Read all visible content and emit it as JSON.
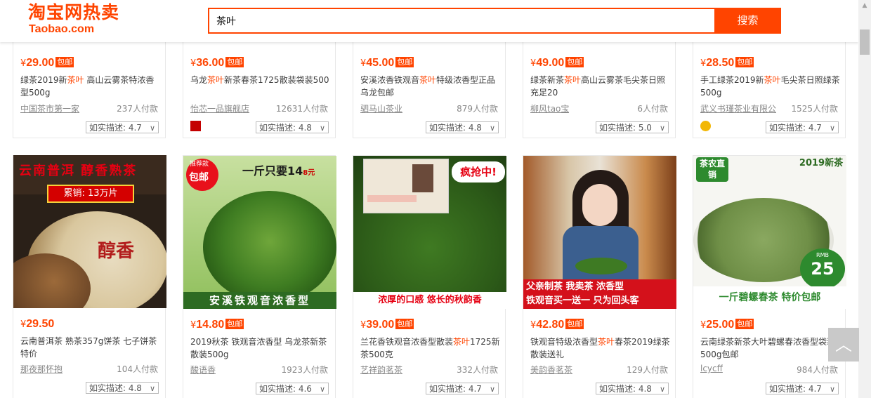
{
  "header": {
    "logo_main": "淘宝网热卖",
    "logo_sub": "Taobao.com",
    "search_value": "茶叶",
    "search_button": "搜索"
  },
  "top_row": [
    {
      "price": "29.00",
      "baoyou": "包邮",
      "title_pre": "绿茶2019新",
      "hl": "茶叶",
      "title_post": " 高山云雾茶特浓香型500g",
      "shop": "中国茶市第一家",
      "sales": "237人付款",
      "rating": "如实描述: 4.7",
      "shop_icon": "none"
    },
    {
      "price": "36.00",
      "baoyou": "包邮",
      "title_pre": "乌龙",
      "hl": "茶叶",
      "title_post": "新茶春茶1725散装袋装500",
      "shop": "怡芯一品旗舰店",
      "sales": "12631人付款",
      "rating": "如实描述: 4.8",
      "shop_icon": "tmall-icon"
    },
    {
      "price": "45.00",
      "baoyou": "包邮",
      "title_pre": "安溪浓香铁观音",
      "hl": "茶叶",
      "title_post": "特级浓香型正品乌龙包邮",
      "shop": "驷马山茶业",
      "sales": "879人付款",
      "rating": "如实描述: 4.8",
      "shop_icon": "none"
    },
    {
      "price": "49.00",
      "baoyou": "包邮",
      "title_pre": "绿茶新茶",
      "hl": "茶叶",
      "title_post": "高山云雾茶毛尖茶日照充足20",
      "shop": "柳风tao宝",
      "sales": "6人付款",
      "rating": "如实描述: 5.0",
      "shop_icon": "none"
    },
    {
      "price": "28.50",
      "baoyou": "包邮",
      "title_pre": "手工绿茶2019新",
      "hl": "茶叶",
      "title_post": "毛尖茶日照绿茶500g",
      "shop": "武义书瑾茶业有限公",
      "sales": "1525人付款",
      "rating": "如实描述: 4.7",
      "shop_icon": "gold-crown-icon"
    }
  ],
  "bottom_row": [
    {
      "price": "29.50",
      "baoyou": "",
      "title_pre": "云南普洱茶 熟茶357g饼茶 七子饼茶 特价",
      "hl": "",
      "title_post": "",
      "shop": "那夜那怀抱",
      "sales": "104人付款",
      "rating": "如实描述: 4.8",
      "pic": {
        "t1": "云南普洱 醇香熟茶",
        "t2": "累销: 13万片",
        "t3": "醇香"
      }
    },
    {
      "price": "14.80",
      "baoyou": "包邮",
      "title_pre": "2019秋茶 铁观音浓香型 乌龙茶新茶散装500g",
      "hl": "",
      "title_post": "",
      "shop": "酸语香",
      "sales": "1923人付款",
      "rating": "如实描述: 4.6",
      "pic": {
        "t1": "包邮",
        "t0": "推荐款",
        "t2": "一斤只要14",
        "t2b": "8元",
        "t3": "安溪铁观音浓香型"
      }
    },
    {
      "price": "39.00",
      "baoyou": "包邮",
      "title_pre": "兰花香铁观音浓香型散装",
      "hl": "茶叶",
      "title_post": "1725新茶500克",
      "shop": "艺祥韵茗茶",
      "sales": "332人付款",
      "rating": "如实描述: 4.7",
      "pic": {
        "t1": "疯抢中!",
        "t3": "浓厚的口感 悠长的秋韵香"
      }
    },
    {
      "price": "42.80",
      "baoyou": "包邮",
      "title_pre": "铁观音特级浓香型",
      "hl": "茶叶",
      "title_post": "春茶2019绿茶散装送礼",
      "shop": "美韵香茗茶",
      "sales": "129人付款",
      "rating": "如实描述: 4.8",
      "pic": {
        "t1": "父亲制茶 我卖茶 浓香型",
        "t2": "铁观音买一送一 只为回头客"
      }
    },
    {
      "price": "25.00",
      "baoyou": "包邮",
      "title_pre": "云南绿茶新茶大叶碧螺春浓香型袋装500g包邮",
      "hl": "",
      "title_post": "",
      "shop": "lcycff",
      "sales": "984人付款",
      "rating": "如实描述: 4.7",
      "pic": {
        "t1": "茶农直销",
        "t2": "2019新茶",
        "t3": "一斤碧螺春茶 特价包邮",
        "t4": "RMB",
        "t5": "25"
      }
    }
  ],
  "price_symbol": "¥",
  "back_to_top": "︿"
}
